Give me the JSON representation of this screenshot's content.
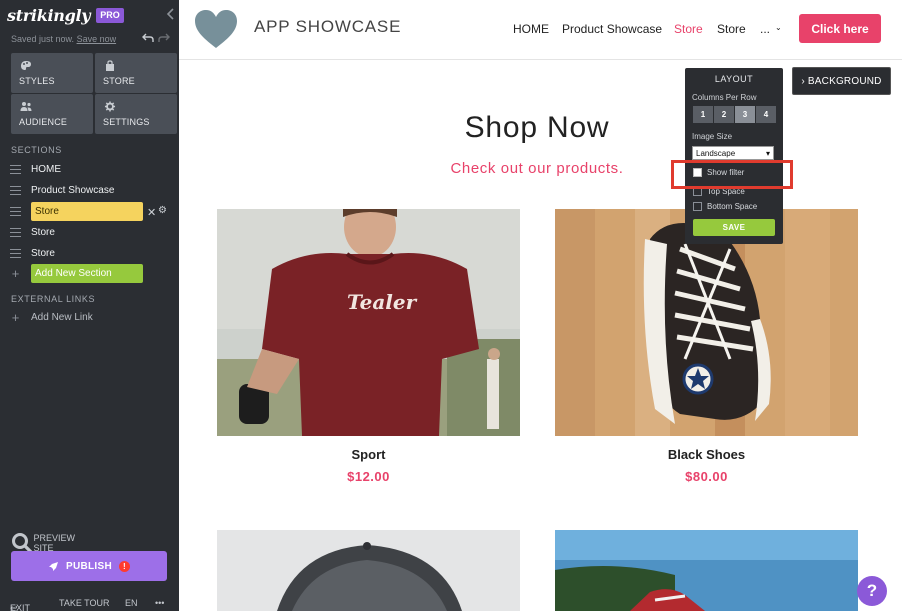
{
  "editor": {
    "logo": "strikingly",
    "plan_badge": "PRO",
    "save_status": "Saved just now.",
    "save_link": "Save now",
    "tiles": [
      {
        "label": "STYLES",
        "icon": "palette-icon"
      },
      {
        "label": "STORE",
        "icon": "bag-icon"
      },
      {
        "label": "AUDIENCE",
        "icon": "people-icon"
      },
      {
        "label": "SETTINGS",
        "icon": "gear-icon"
      }
    ],
    "sections_heading": "SECTIONS",
    "sections": [
      {
        "label": "HOME"
      },
      {
        "label": "Product Showcase"
      },
      {
        "label": "Store",
        "active": true
      },
      {
        "label": "Store"
      },
      {
        "label": "Store"
      }
    ],
    "add_section": "Add New Section",
    "external_heading": "EXTERNAL LINKS",
    "add_link": "Add New Link",
    "preview": "PREVIEW SITE",
    "publish": "PUBLISH",
    "footer": {
      "exit": "EXIT",
      "tour": "TAKE TOUR",
      "lang": "EN",
      "more": "•••"
    }
  },
  "site": {
    "title": "APP SHOWCASE",
    "nav": [
      {
        "label": "HOME"
      },
      {
        "label": "Product Showcase"
      },
      {
        "label": "Store",
        "active": true
      },
      {
        "label": "Store"
      },
      {
        "label": "..."
      }
    ],
    "cta": "Click here",
    "heading": "Shop Now",
    "subheading": "Check out our products.",
    "products": [
      {
        "name": "Sport",
        "price": "$12.00"
      },
      {
        "name": "Black Shoes",
        "price": "$80.00"
      }
    ]
  },
  "layout_panel": {
    "title": "LAYOUT",
    "columns_label": "Columns Per Row",
    "columns": [
      "1",
      "2",
      "3",
      "4"
    ],
    "selected_columns": "3",
    "image_size_label": "Image Size",
    "image_size_value": "Landscape",
    "checkboxes": [
      {
        "label": "Show filter",
        "checked": false
      },
      {
        "label": "Top Space",
        "checked": false
      },
      {
        "label": "Bottom Space",
        "checked": false
      }
    ],
    "save": "SAVE"
  },
  "background_button": "BACKGROUND",
  "help": "?",
  "colors": {
    "accent": "#e8426a",
    "sidebar": "#2b2e33",
    "purple": "#9d6fe8",
    "green": "#96c93d",
    "yellow": "#f5d35e"
  }
}
